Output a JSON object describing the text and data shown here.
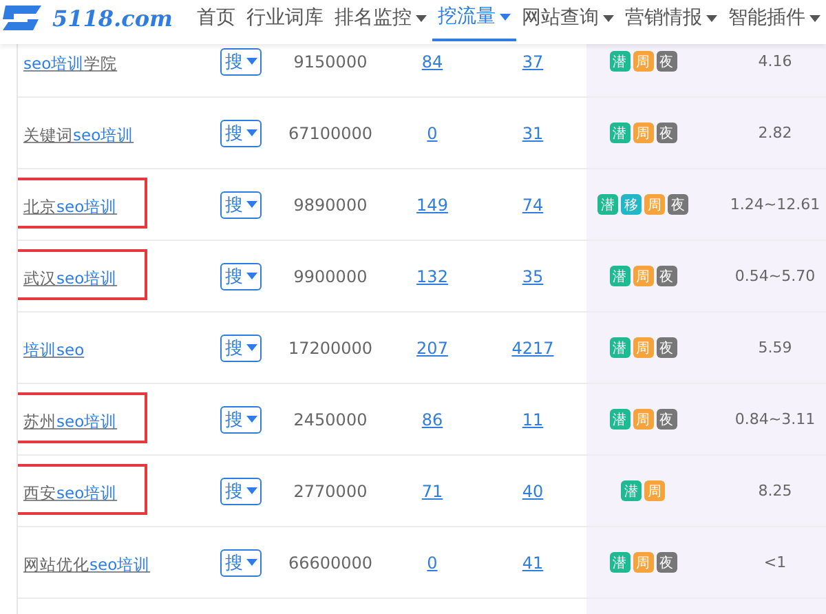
{
  "logo": {
    "text": "5118.com"
  },
  "nav": [
    {
      "label": "首页",
      "selected": false,
      "dropdown": false
    },
    {
      "label": "行业词库",
      "selected": false,
      "dropdown": false
    },
    {
      "label": "排名监控",
      "selected": false,
      "dropdown": true
    },
    {
      "label": "挖流量",
      "selected": true,
      "dropdown": true
    },
    {
      "label": "网站查询",
      "selected": false,
      "dropdown": true
    },
    {
      "label": "营销情报",
      "selected": false,
      "dropdown": true
    },
    {
      "label": "智能插件",
      "selected": false,
      "dropdown": true
    }
  ],
  "rows": [
    {
      "keyword": [
        {
          "text": "seo培训",
          "highlight": true
        },
        {
          "text": "学院",
          "highlight": false
        }
      ],
      "search": "搜",
      "index": "9150000",
      "column_4": "84",
      "column_5": "37",
      "tags": [
        {
          "text": "潜",
          "color": "#1fb992"
        },
        {
          "text": "周",
          "color": "#f5a33a"
        },
        {
          "text": "夜",
          "color": "#777777"
        }
      ],
      "value": "4.16",
      "boxed": false
    },
    {
      "keyword": [
        {
          "text": "关键词",
          "highlight": false
        },
        {
          "text": "seo培训",
          "highlight": true
        }
      ],
      "search": "搜",
      "index": "67100000",
      "column_4": "0",
      "column_5": "31",
      "tags": [
        {
          "text": "潜",
          "color": "#1fb992"
        },
        {
          "text": "周",
          "color": "#f5a33a"
        },
        {
          "text": "夜",
          "color": "#777777"
        }
      ],
      "value": "2.82",
      "boxed": false
    },
    {
      "keyword": [
        {
          "text": "北京",
          "highlight": false
        },
        {
          "text": "seo培训",
          "highlight": true
        }
      ],
      "search": "搜",
      "index": "9890000",
      "column_4": "149",
      "column_5": "74",
      "tags": [
        {
          "text": "潜",
          "color": "#1fb992"
        },
        {
          "text": "移",
          "color": "#20b8c8"
        },
        {
          "text": "周",
          "color": "#f5a33a"
        },
        {
          "text": "夜",
          "color": "#777777"
        }
      ],
      "value": "1.24~12.61",
      "boxed": true
    },
    {
      "keyword": [
        {
          "text": "武汉",
          "highlight": false
        },
        {
          "text": "seo培训",
          "highlight": true
        }
      ],
      "search": "搜",
      "index": "9900000",
      "column_4": "132",
      "column_5": "35",
      "tags": [
        {
          "text": "潜",
          "color": "#1fb992"
        },
        {
          "text": "周",
          "color": "#f5a33a"
        },
        {
          "text": "夜",
          "color": "#777777"
        }
      ],
      "value": "0.54~5.70",
      "boxed": true
    },
    {
      "keyword": [
        {
          "text": "培训seo",
          "highlight": true
        }
      ],
      "search": "搜",
      "index": "17200000",
      "column_4": "207",
      "column_5": "4217",
      "tags": [
        {
          "text": "潜",
          "color": "#1fb992"
        },
        {
          "text": "周",
          "color": "#f5a33a"
        },
        {
          "text": "夜",
          "color": "#777777"
        }
      ],
      "value": "5.59",
      "boxed": false
    },
    {
      "keyword": [
        {
          "text": "苏州",
          "highlight": false
        },
        {
          "text": "seo培训",
          "highlight": true
        }
      ],
      "search": "搜",
      "index": "2450000",
      "column_4": "86",
      "column_5": "11",
      "tags": [
        {
          "text": "潜",
          "color": "#1fb992"
        },
        {
          "text": "周",
          "color": "#f5a33a"
        },
        {
          "text": "夜",
          "color": "#777777"
        }
      ],
      "value": "0.84~3.11",
      "boxed": true
    },
    {
      "keyword": [
        {
          "text": "西安",
          "highlight": false
        },
        {
          "text": "seo培训",
          "highlight": true
        }
      ],
      "search": "搜",
      "index": "2770000",
      "column_4": "71",
      "column_5": "40",
      "tags": [
        {
          "text": "潜",
          "color": "#1fb992"
        },
        {
          "text": "周",
          "color": "#f5a33a"
        }
      ],
      "value": "8.25",
      "boxed": true
    },
    {
      "keyword": [
        {
          "text": "网站优化",
          "highlight": false
        },
        {
          "text": "seo培训",
          "highlight": true
        }
      ],
      "search": "搜",
      "index": "66600000",
      "column_4": "0",
      "column_5": "41",
      "tags": [
        {
          "text": "潜",
          "color": "#1fb992"
        },
        {
          "text": "周",
          "color": "#f5a33a"
        },
        {
          "text": "夜",
          "color": "#777777"
        }
      ],
      "value": "<1",
      "boxed": false
    }
  ]
}
